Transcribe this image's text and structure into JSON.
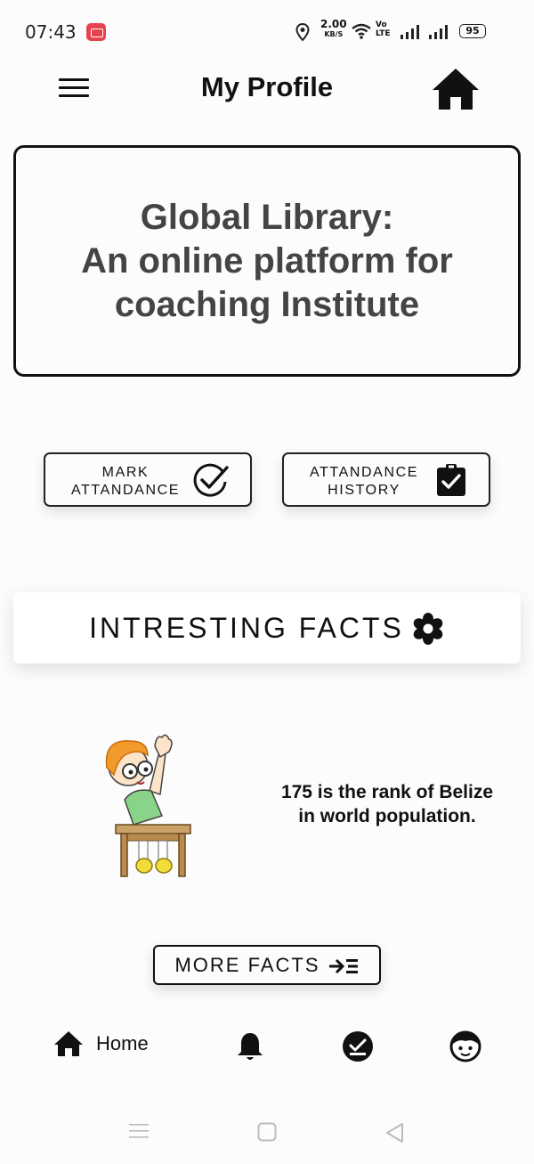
{
  "status_bar": {
    "time": "07:43",
    "speed_value": "2.00",
    "speed_unit": "KB/S",
    "volte_line1": "Vo",
    "volte_line2": "LTE",
    "battery": "95"
  },
  "header": {
    "title": "My Profile"
  },
  "banner": {
    "text": "Global Library:\nAn online platform for\ncoaching Institute"
  },
  "attendance": {
    "mark_label": "MARK\nATTANDANCE",
    "history_label": "ATTANDANCE\nHISTORY"
  },
  "facts": {
    "title": "INTRESTING FACTS",
    "fact_text": "175 is the rank of Belize\nin world population.",
    "more_label": "MORE FACTS"
  },
  "bottom_nav": {
    "home_label": "Home",
    "items": [
      "home-icon",
      "bell-icon",
      "check-icon",
      "face-icon"
    ]
  },
  "colors": {
    "background": "#fdfcfd",
    "text": "#111111",
    "banner_text": "#444444",
    "record_red": "#e8424f"
  }
}
